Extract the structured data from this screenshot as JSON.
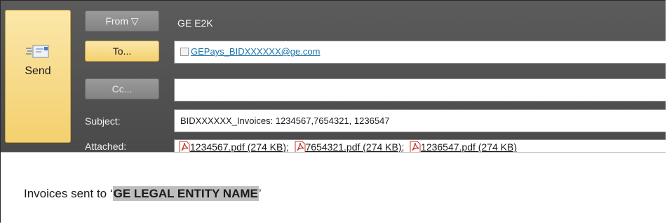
{
  "send": {
    "label": "Send",
    "icon": "envelope-send-icon"
  },
  "from": {
    "button_label": "From ▽",
    "value": "GE E2K"
  },
  "to": {
    "button_label": "To...",
    "recipient": "GEPays_BIDXXXXXX@ge.com"
  },
  "cc": {
    "button_label": "Cc...",
    "value": ""
  },
  "subject": {
    "label": "Subject:",
    "value": "BIDXXXXXX_Invoices: 1234567,7654321, 1236547"
  },
  "attached": {
    "label": "Attached:",
    "files": [
      {
        "name": "1234567.pdf (274 KB)",
        "icon": "pdf-icon"
      },
      {
        "name": "7654321.pdf (274 KB)",
        "icon": "pdf-icon"
      },
      {
        "name": "1236547.pdf (274 KB)",
        "icon": "pdf-icon"
      }
    ],
    "separator": ";"
  },
  "message": {
    "prefix": "Invoices sent to ‘",
    "entity": "GE LEGAL ENTITY NAME",
    "suffix": "’"
  },
  "colors": {
    "header_bg": "#4f4f4f",
    "accent_button": "#f4d06e",
    "link": "#1a73a8",
    "highlight": "#bebebe"
  }
}
